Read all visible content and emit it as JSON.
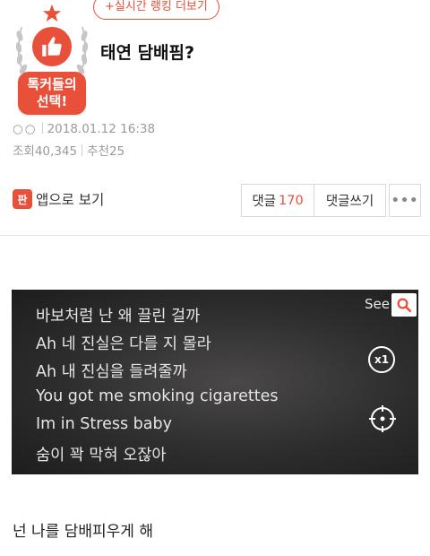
{
  "badge": {
    "label_line1": "톡커들의",
    "label_line2": "선택!",
    "icons": [
      "star-icon",
      "thumbs-up-icon",
      "laurel-wreath-icon"
    ]
  },
  "ranking_link": "+실시간 랭킹 더보기",
  "post": {
    "title": "태연 담배핌?",
    "author": "○○",
    "datetime": "2018.01.12 16:38",
    "views_label": "조회",
    "views": "40,345",
    "recommend_label": "추천",
    "recommend": "25"
  },
  "actions": {
    "app_icon_glyph": "판",
    "app_view": "앱으로 보기",
    "comments_label": "댓글",
    "comments_count": "170",
    "write_comment": "댓글쓰기",
    "more": "•••"
  },
  "video": {
    "lyrics": [
      {
        "text": "바보처럼 난 왜 끌린 걸까"
      },
      {
        "text": "Ah 네 진실은 다를 지 몰라"
      },
      {
        "text": "Ah 내 진심을 들려줄까"
      },
      {
        "text": "You got me smoking cigarettes"
      },
      {
        "text": "Im in Stress baby"
      },
      {
        "text": "숨이 꽉 막혀 오잖아"
      }
    ],
    "see_label": "See",
    "speed_label": "x1"
  },
  "caption": "넌 나를 담배피우게 해",
  "colors": {
    "accent": "#e8503a",
    "meta_text": "#9a9a9a",
    "video_bg": "#2e2d2d"
  }
}
